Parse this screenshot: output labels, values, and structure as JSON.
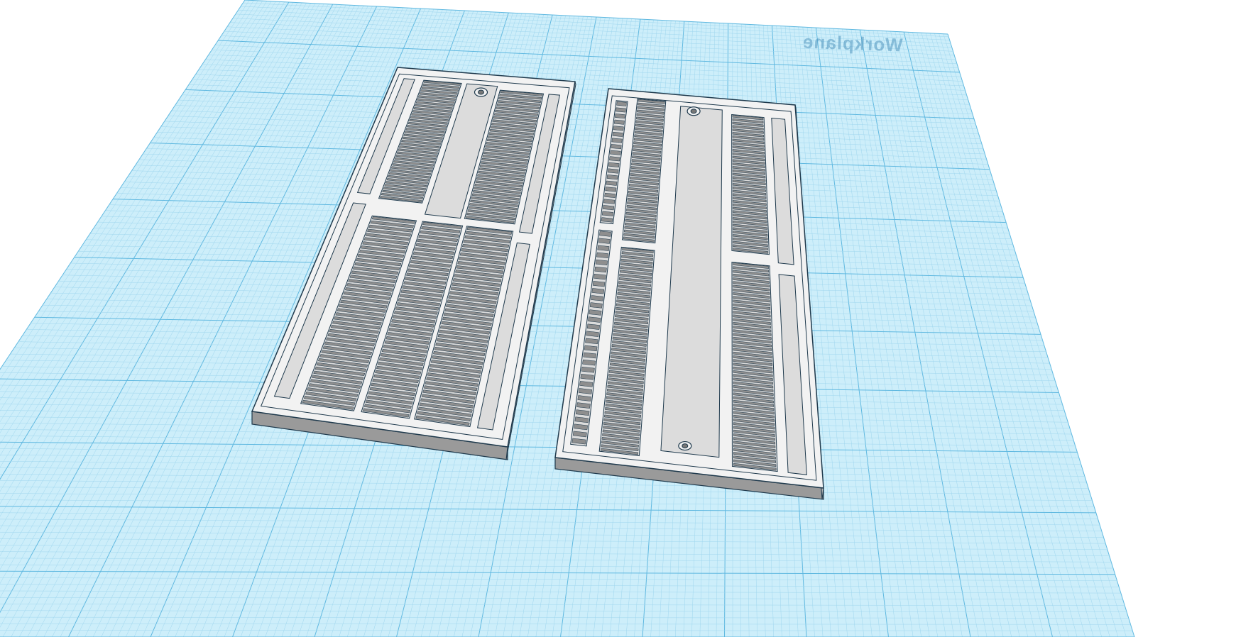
{
  "workplane": {
    "label": "Workplane"
  },
  "colors": {
    "plane": "#cdeefa",
    "grid_minor": "#9fd6ee",
    "grid_major": "#5fb8e0",
    "part_top": "#f2f2f2",
    "part_side": "#9a9a9a",
    "edge": "#1f3a4d"
  }
}
